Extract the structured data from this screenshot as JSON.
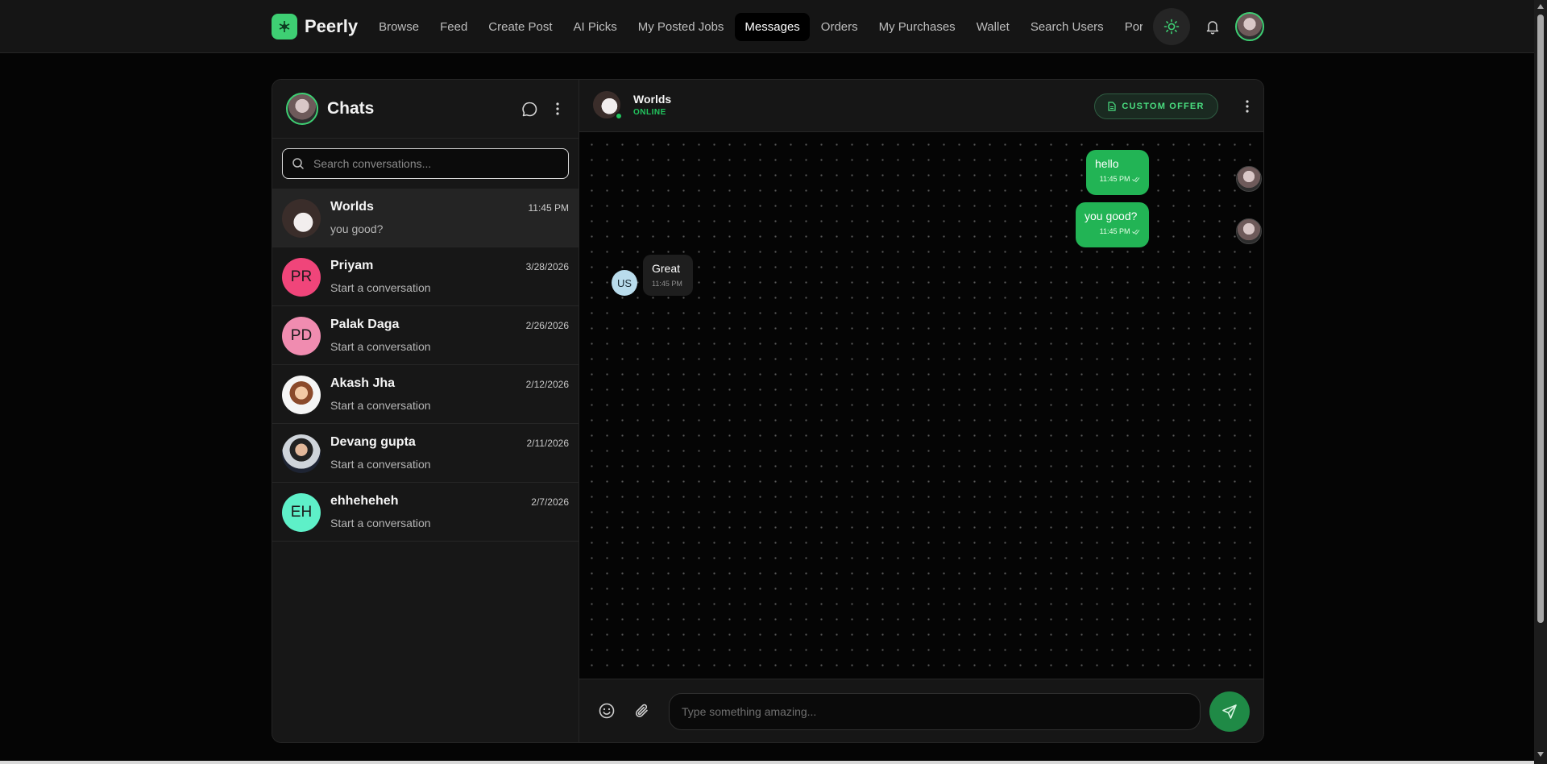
{
  "app": {
    "name": "Peerly",
    "brand_color": "#3ecf73"
  },
  "nav": {
    "items": [
      {
        "label": "Browse",
        "active": false
      },
      {
        "label": "Feed",
        "active": false
      },
      {
        "label": "Create Post",
        "active": false
      },
      {
        "label": "AI Picks",
        "active": false
      },
      {
        "label": "My Posted Jobs",
        "active": false
      },
      {
        "label": "Messages",
        "active": true
      },
      {
        "label": "Orders",
        "active": false
      },
      {
        "label": "My Purchases",
        "active": false
      },
      {
        "label": "Wallet",
        "active": false
      },
      {
        "label": "Search Users",
        "active": false
      },
      {
        "label": "Portfolio",
        "active": false
      }
    ]
  },
  "sidebar": {
    "title": "Chats",
    "search_placeholder": "Search conversations...",
    "conversations": [
      {
        "name": "Worlds",
        "last": "you good?",
        "time": "11:45 PM",
        "initials": "",
        "color": "#3a2d2a",
        "active": true
      },
      {
        "name": "Priyam",
        "last": "Start a conversation",
        "time": "3/28/2026",
        "initials": "PR",
        "color": "#f0457a",
        "active": false
      },
      {
        "name": "Palak Daga",
        "last": "Start a conversation",
        "time": "2/26/2026",
        "initials": "PD",
        "color": "#f08cb0",
        "active": false
      },
      {
        "name": "Akash Jha",
        "last": "Start a conversation",
        "time": "2/12/2026",
        "initials": "",
        "color": "#f5f5f5",
        "active": false
      },
      {
        "name": "Devang gupta",
        "last": "Start a conversation",
        "time": "2/11/2026",
        "initials": "",
        "color": "#cfd4da",
        "active": false
      },
      {
        "name": "ehheheheh",
        "last": "Start a conversation",
        "time": "2/7/2026",
        "initials": "EH",
        "color": "#5ef0c8",
        "active": false
      }
    ]
  },
  "chat": {
    "name": "Worlds",
    "status": "ONLINE",
    "offer_label": "CUSTOM OFFER",
    "messages": {
      "m1": {
        "text": "hello",
        "time": "11:45 PM"
      },
      "m2": {
        "text": "you good?",
        "time": "11:45 PM"
      },
      "m3": {
        "text": "Great",
        "time": "11:45 PM",
        "initials": "US"
      }
    },
    "composer_placeholder": "Type something amazing..."
  },
  "colors": {
    "accent": "#22b455",
    "online": "#22c55e"
  }
}
